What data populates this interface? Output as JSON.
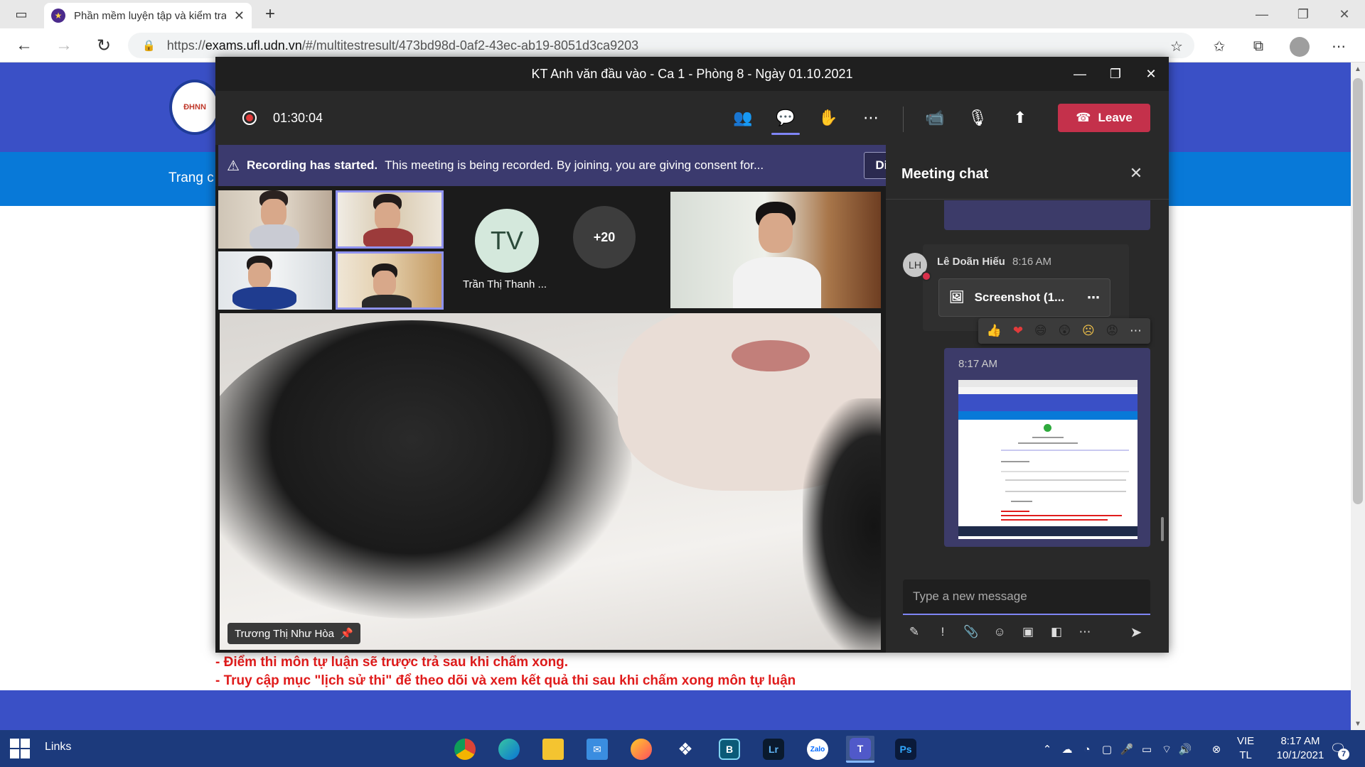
{
  "browser": {
    "tab_title": "Phần mềm luyện tập và kiểm tra",
    "url_prefix": "https://",
    "url_host": "exams.ufl.udn.vn",
    "url_path": "/#/multitestresult/473bd98d-0af2-43ec-ab19-8051d3ca9203"
  },
  "webpage": {
    "logo_text": "ĐHNN",
    "nav_text": "Trang c",
    "note_1": "- Điểm thi môn tự luận sẽ trược trả sau khi chấm xong.",
    "note_2": "- Truy cập mục \"lịch sử thi\" để theo dõi và xem kết quả thi sau khi chấm xong môn tự luận"
  },
  "teams": {
    "window_title": "KT Anh văn đầu vào - Ca 1 - Phòng 8 - Ngày 01.10.2021",
    "timer": "01:30:04",
    "leave_label": "Leave",
    "banner_bold": "Recording has started.",
    "banner_text": "This meeting is being recorded. By joining, you are giving consent for...",
    "dismiss_label": "Dismiss",
    "tv_initials": "TV",
    "tv_name": "Trần Thị Thanh ...",
    "more_count": "+20",
    "main_speaker": "Trương Thị Như Hòa"
  },
  "chat": {
    "title": "Meeting chat",
    "author_initials": "LH",
    "author_name": "Lê Doãn Hiếu",
    "author_time": "8:16 AM",
    "file_name": "Screenshot (1...",
    "reactions": [
      "👍",
      "❤",
      "😄",
      "😲",
      "☹",
      "😡",
      "⋯"
    ],
    "my_time": "8:17 AM",
    "compose_placeholder": "Type a new message"
  },
  "taskbar": {
    "links_label": "Links",
    "lang_1": "VIE",
    "lang_2": "TL",
    "time": "8:17 AM",
    "date": "10/1/2021",
    "notif_count": "7"
  },
  "colors": {
    "teams_accent": "#7f85f5",
    "leave_red": "#c4314b",
    "page_blue": "#3a50c6",
    "page_nav_blue": "#0879d8",
    "note_red": "#e01c1c"
  }
}
